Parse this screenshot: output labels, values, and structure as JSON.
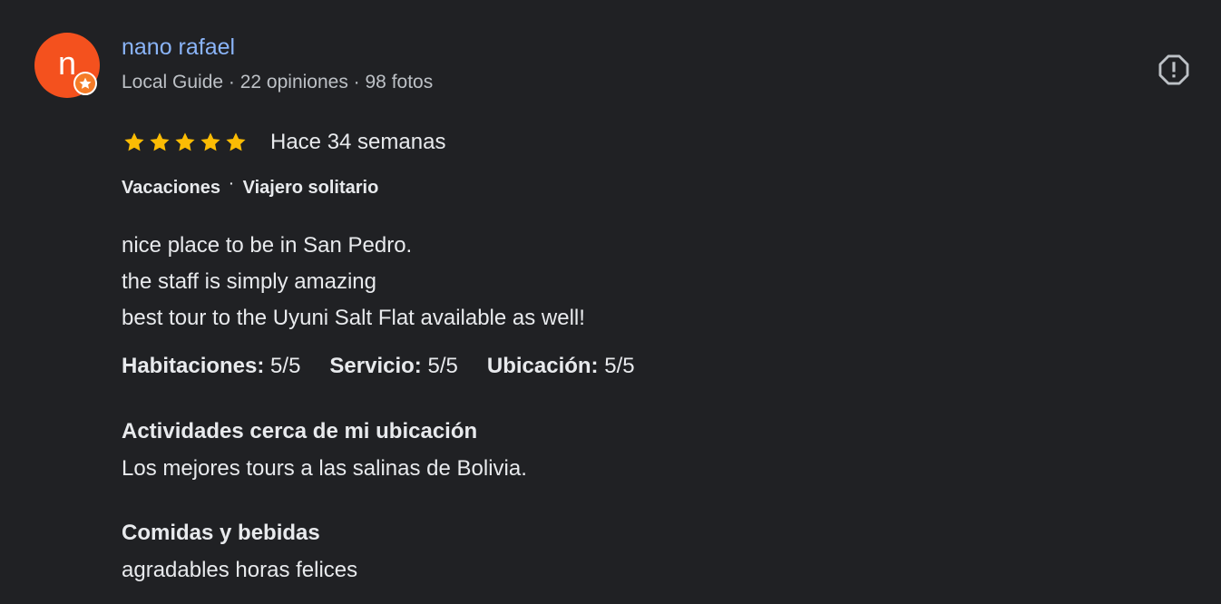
{
  "author": {
    "initial": "n",
    "name": "nano rafael",
    "meta": "Local Guide · 22 opiniones · 98 fotos",
    "avatar_color": "#f4511e",
    "badge_icon": "star-icon"
  },
  "rating": {
    "stars": 5,
    "max_stars": 5,
    "star_color": "#fbbc04",
    "date": "Hace 34 semanas"
  },
  "tags": {
    "trip_type": "Vacaciones",
    "separator": "·",
    "travel_group": "Viajero solitario"
  },
  "review_lines": [
    "nice place to be in San Pedro.",
    "the staff is simply amazing",
    "best tour to the Uyuni Salt Flat available as well!"
  ],
  "subratings": [
    {
      "label": "Habitaciones:",
      "value": "5/5"
    },
    {
      "label": "Servicio:",
      "value": "5/5"
    },
    {
      "label": "Ubicación:",
      "value": "5/5"
    }
  ],
  "sections": [
    {
      "title": "Actividades cerca de mi ubicación",
      "text": "Los mejores tours a las salinas de Bolivia."
    },
    {
      "title": "Comidas y bebidas",
      "text": "agradables horas felices"
    }
  ],
  "report_icon": "report-icon"
}
